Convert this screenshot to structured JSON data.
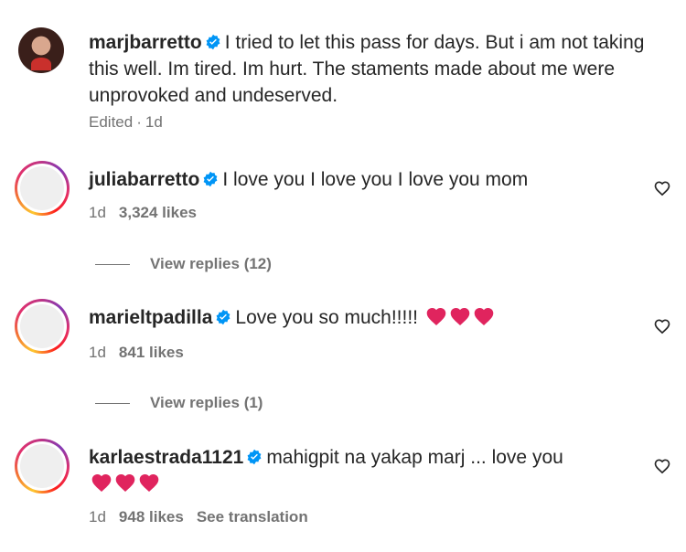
{
  "caption": {
    "username": "marjbarretto",
    "text": "I tried to let this pass for days. But i am not taking this well. Im tired. Im hurt. The staments made about me were unprovoked and undeserved.",
    "edited": "Edited",
    "separator": "·",
    "time": "1d"
  },
  "comments": [
    {
      "username": "juliabarretto",
      "text": "I love you I love you I love you mom",
      "time": "1d",
      "likes": "3,324 likes",
      "view_replies": "View replies (12)"
    },
    {
      "username": "marieltpadilla",
      "text": "Love you so much!!!!!",
      "time": "1d",
      "likes": "841 likes",
      "view_replies": "View replies (1)"
    },
    {
      "username": "karlaestrada1121",
      "text": "mahigpit na yakap marj ... love you",
      "time": "1d",
      "likes": "948 likes",
      "see_translation": "See translation"
    }
  ],
  "colors": {
    "verified_blue": "#0095f6",
    "heart_red": "#e0245e",
    "meta_gray": "#737373"
  },
  "icons": {
    "verified": "verified-badge-icon",
    "like": "heart-outline-icon",
    "emoji": "red-heart-emoji"
  }
}
